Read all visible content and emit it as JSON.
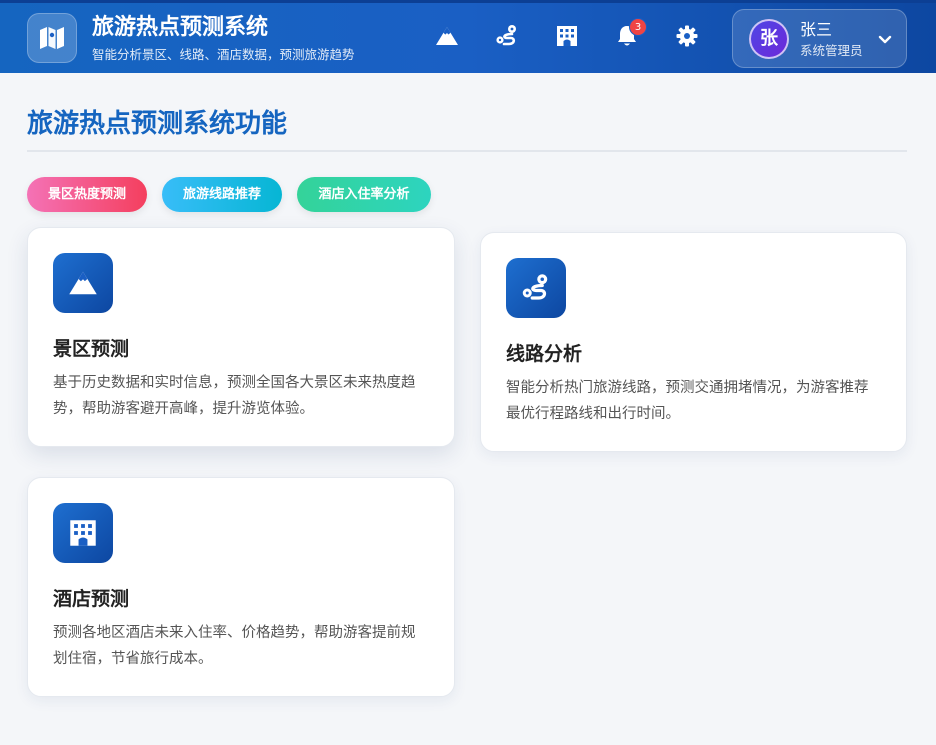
{
  "header": {
    "title": "旅游热点预测系统",
    "subtitle": "智能分析景区、线路、酒店数据，预测旅游趋势",
    "nav": [
      "mountain-icon",
      "route-icon",
      "hotel-icon",
      "bell-icon",
      "gear-icon"
    ],
    "notification_count": "3",
    "user": {
      "avatar_char": "张",
      "name": "张三",
      "role": "系统管理员"
    }
  },
  "main": {
    "section_title": "旅游热点预测系统功能",
    "tags": [
      "景区热度预测",
      "旅游线路推荐",
      "酒店入住率分析"
    ],
    "cards": [
      {
        "icon": "mountain-icon",
        "title": "景区预测",
        "desc": "基于历史数据和实时信息，预测全国各大景区未来热度趋势，帮助游客避开高峰，提升游览体验。"
      },
      {
        "icon": "route-icon",
        "title": "线路分析",
        "desc": "智能分析热门旅游线路，预测交通拥堵情况，为游客推荐最优行程路线和出行时间。"
      },
      {
        "icon": "hotel-icon",
        "title": "酒店预测",
        "desc": "预测各地区酒店未来入住率、价格趋势，帮助游客提前规划住宿，节省旅行成本。"
      }
    ]
  },
  "colors": {
    "primary": "#1565c0",
    "header_bg": "#1a5fc4",
    "badge": "#ef4444",
    "page_bg": "#f4f6f9"
  }
}
